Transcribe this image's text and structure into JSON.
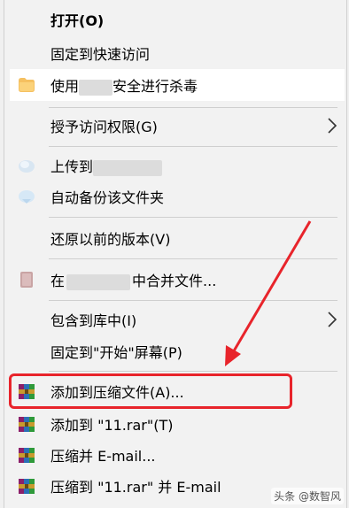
{
  "menu": {
    "open": "打开(O)",
    "pin_quick_access": "固定到快速访问",
    "scan_prefix": "使用",
    "scan_suffix": "安全进行杀毒",
    "grant_access": "授予访问权限(G)",
    "upload_to": "上传到",
    "auto_backup": "自动备份该文件夹",
    "restore_previous": "还原以前的版本(V)",
    "merge_prefix": "在",
    "merge_suffix": "中合并文件...",
    "include_in_library": "包含到库中(I)",
    "pin_start": "固定到\"开始\"屏幕(P)",
    "add_to_archive": "添加到压缩文件(A)...",
    "add_to_rar": "添加到 \"11.rar\"(T)",
    "compress_email": "压缩并 E-mail...",
    "compress_rar_email": "压缩到 \"11.rar\" 并 E-mail"
  },
  "watermark": "头条 @数智风",
  "colors": {
    "highlight_box": "#e8242b",
    "arrow": "#e8242b",
    "menu_bg": "#f2f2f2"
  },
  "icons": {
    "scan": "shield-scan-icon",
    "upload": "cloud-upload-icon",
    "backup": "cloud-backup-icon",
    "merge": "pdf-merge-icon",
    "winrar": "winrar-books-icon",
    "submenu": "chevron-right-icon"
  }
}
